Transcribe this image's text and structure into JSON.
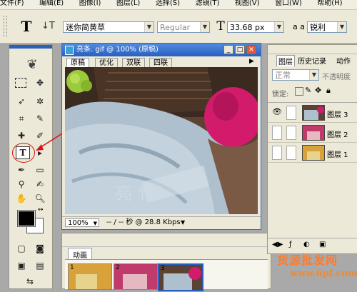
{
  "menubar": {
    "items": [
      "文件(F)",
      "编辑(E)",
      "图像(I)",
      "图层(L)",
      "选择(S)",
      "滤镜(T)",
      "视图(V)",
      "窗口(W)",
      "帮助(H)"
    ]
  },
  "options": {
    "font_family": "迷你简黄草",
    "font_style": "Regular",
    "font_size": "33.68 px",
    "antialias_label": "a a",
    "antialias": "锐利"
  },
  "document": {
    "title": "亮条. gif @ 100% (原稿)",
    "tabs": [
      "原稿",
      "优化",
      "双联",
      "四联"
    ],
    "zoom": "100%",
    "status": "-- / -- 秒 @ 28.8 Kbps"
  },
  "animation": {
    "title": "动画",
    "frames": [
      "1",
      "2",
      "3"
    ]
  },
  "layers": {
    "tabs": [
      "图层",
      "历史记录",
      "动作"
    ],
    "blend_mode": "正常",
    "opacity_label": "不透明度",
    "lock_label": "锁定:",
    "items": [
      {
        "name": "图层 3",
        "visible": true
      },
      {
        "name": "图层 2",
        "visible": false
      },
      {
        "name": "图层 1",
        "visible": false
      }
    ]
  },
  "watermark": {
    "line1": "货源批发网",
    "line2": "www.6pf.com"
  }
}
